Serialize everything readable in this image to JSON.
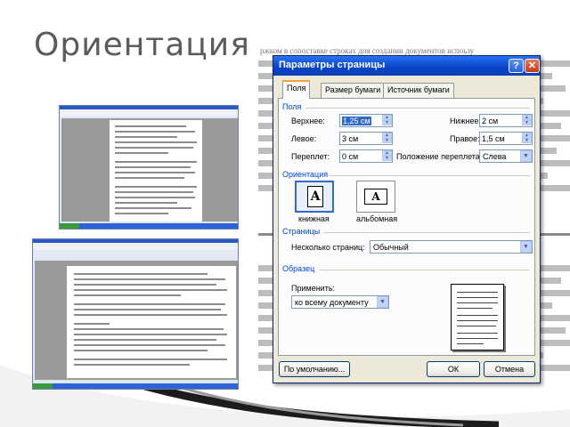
{
  "slide": {
    "title": "Ориентация"
  },
  "dialog": {
    "title": "Параметры страницы",
    "help_label": "?",
    "close_label": "✕",
    "tabs": [
      {
        "label": "Поля",
        "active": true
      },
      {
        "label": "Размер бумаги",
        "active": false
      },
      {
        "label": "Источник бумаги",
        "active": false
      }
    ],
    "margins": {
      "section_label": "Поля",
      "top_label": "Верхнее:",
      "top_value": "1,25 см",
      "bottom_label": "Нижнее:",
      "bottom_value": "2 см",
      "left_label": "Левое:",
      "left_value": "3 см",
      "right_label": "Правое:",
      "right_value": "1,5 см",
      "gutter_label": "Переплет:",
      "gutter_value": "0 см",
      "gutter_pos_label": "Положение переплета:",
      "gutter_pos_value": "Слева"
    },
    "orientation": {
      "section_label": "Ориентация",
      "portrait_label": "книжная",
      "landscape_label": "альбомная",
      "icon_letter": "A",
      "selected": "portrait"
    },
    "pages": {
      "section_label": "Страницы",
      "multiple_label": "Несколько страниц:",
      "multiple_value": "Обычный"
    },
    "sample": {
      "section_label": "Образец",
      "apply_label": "Применить:",
      "apply_value": "ко всему документу"
    },
    "buttons": {
      "default_label": "По умолчанию...",
      "ok_label": "ОК",
      "cancel_label": "Отмена"
    }
  },
  "background_text": {
    "line1": "ржком в сопоставке строках дня создании документов испоьзу"
  },
  "colors": {
    "title_bar": "#0842c7",
    "section_label": "#0046d5",
    "selection": "#316ac5",
    "tab_accent": "#f0a43a"
  }
}
